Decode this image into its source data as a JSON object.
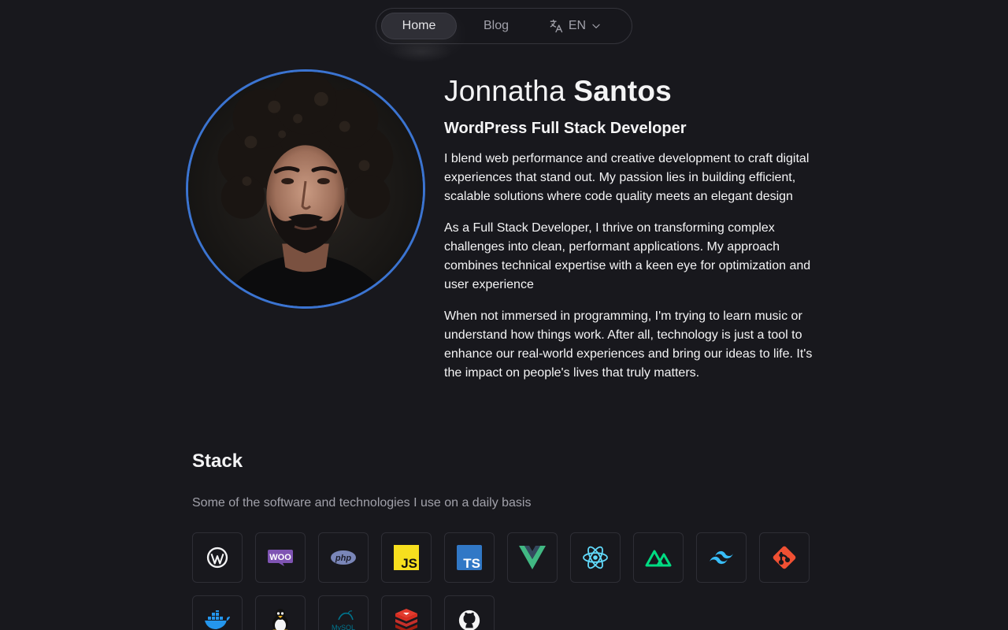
{
  "nav": {
    "home_label": "Home",
    "blog_label": "Blog",
    "lang_label": "EN",
    "lang_icon": "translate-icon",
    "dropdown_icon": "chevron-down-icon"
  },
  "profile": {
    "first_name": "Jonnatha",
    "last_name": "Santos",
    "role": "WordPress Full Stack Developer",
    "paragraphs": [
      "I blend web performance and creative development to craft digital experiences that stand out. My passion lies in building efficient, scalable solutions where code quality meets an elegant design",
      "As a Full Stack Developer, I thrive on transforming complex challenges into clean, performant applications. My approach combines technical expertise with a keen eye for optimization and user experience",
      "When not immersed in programming, I'm trying to learn music or understand how things work. After all, technology is just a tool to enhance our real-world experiences and bring our ideas to life. It's the impact on people's lives that truly matters."
    ],
    "avatar_ring_color": "#3b74d1"
  },
  "stack": {
    "title": "Stack",
    "subtitle": "Some of the software and technologies I use on a daily basis",
    "items": [
      {
        "icon": "wordpress-icon"
      },
      {
        "icon": "woocommerce-icon",
        "text": "WOO"
      },
      {
        "icon": "php-icon",
        "text": "php"
      },
      {
        "icon": "javascript-icon",
        "text": "JS"
      },
      {
        "icon": "typescript-icon",
        "text": "TS"
      },
      {
        "icon": "vue-icon"
      },
      {
        "icon": "react-icon"
      },
      {
        "icon": "nuxt-icon"
      },
      {
        "icon": "tailwind-icon"
      },
      {
        "icon": "git-icon"
      },
      {
        "icon": "docker-icon"
      },
      {
        "icon": "linux-icon"
      },
      {
        "icon": "mysql-icon",
        "text": "MySQL"
      },
      {
        "icon": "redis-icon"
      },
      {
        "icon": "github-icon"
      }
    ]
  },
  "colors": {
    "background": "#18181d",
    "text": "#f4f4f5",
    "muted": "#a1a1aa",
    "border": "#2e2e35"
  }
}
